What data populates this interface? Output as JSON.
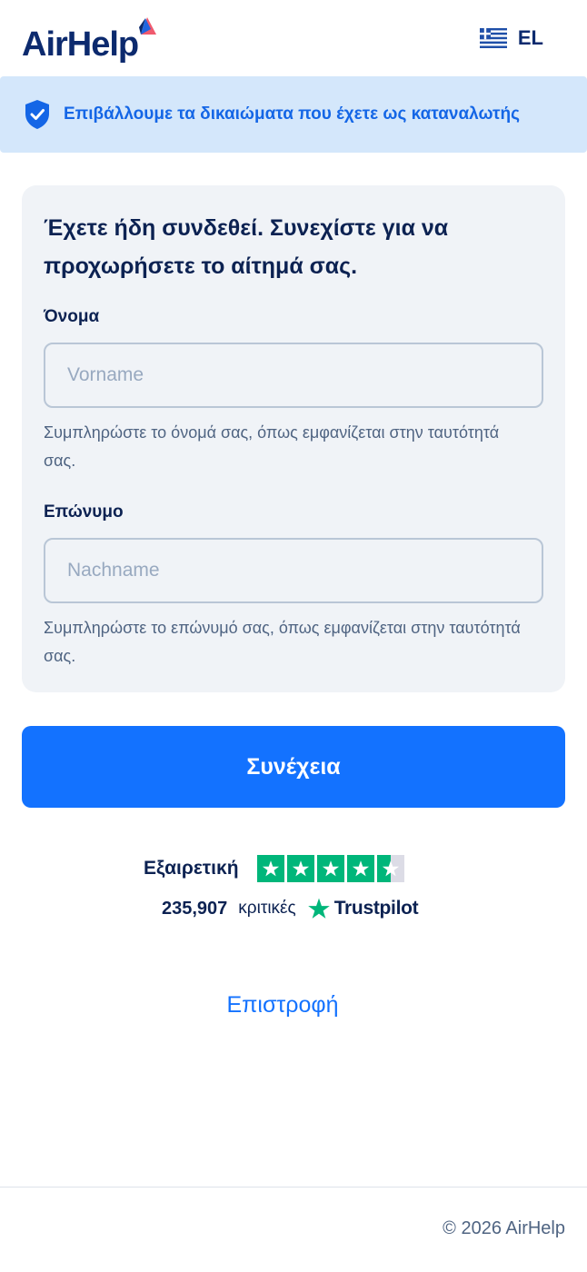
{
  "header": {
    "logo_text": "AirHelp",
    "language": {
      "code": "EL",
      "flag_icon": "greece-flag-icon"
    }
  },
  "banner": {
    "icon": "shield-check-icon",
    "text": "Επιβάλλουμε τα δικαιώματα που έχετε ως καταναλωτής"
  },
  "form": {
    "title": "Έχετε ήδη συνδεθεί. Συνεχίστε για να προχωρήσετε το αίτημά σας.",
    "first_name": {
      "label": "Όνομα",
      "value": "",
      "placeholder": "Vorname",
      "help": "Συμπληρώστε το όνομά σας, όπως εμφανίζεται στην ταυτότητά σας."
    },
    "last_name": {
      "label": "Επώνυμο",
      "value": "",
      "placeholder": "Nachname",
      "help": "Συμπληρώστε το επώνυμό σας, όπως εμφανίζεται στην ταυτότητά σας."
    }
  },
  "continue_button": {
    "label": "Συνέχεια"
  },
  "trustpilot": {
    "rating_text": "Εξαιρετική",
    "stars_filled": 4.5,
    "stars_total": 5,
    "review_count": "235,907",
    "review_label": "κριτικές",
    "brand": "Trustpilot"
  },
  "back_link": {
    "label": "Επιστροφή"
  },
  "footer": {
    "copyright": "© 2026 AirHelp"
  },
  "colors": {
    "brand_navy": "#0c2a6e",
    "primary_blue": "#1372ff",
    "banner_bg": "#d4e7fb",
    "card_bg": "#f0f3f7",
    "trustpilot_green": "#00b67a"
  }
}
